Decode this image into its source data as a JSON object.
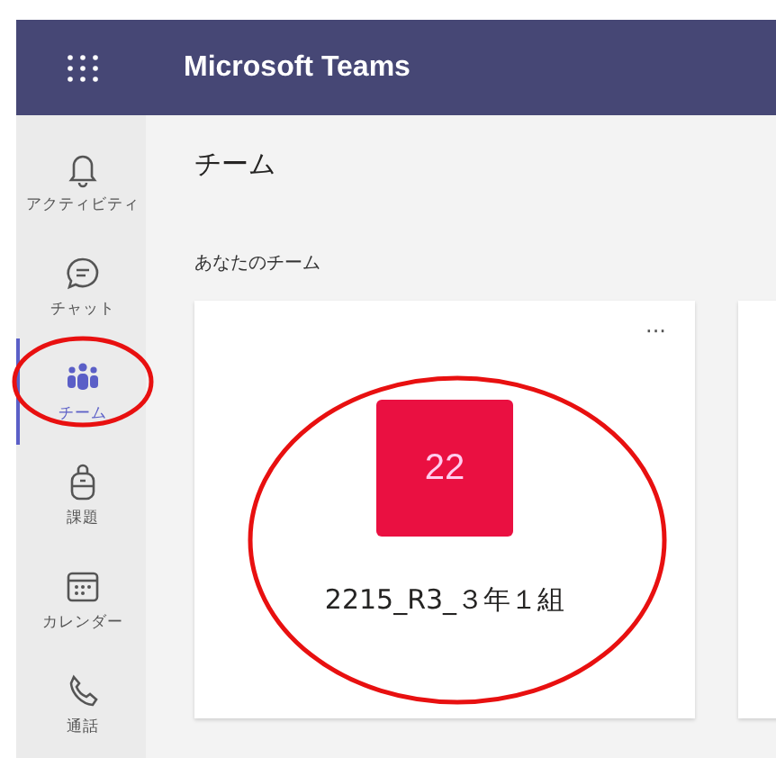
{
  "header": {
    "title": "Microsoft Teams"
  },
  "sidebar": {
    "items": [
      {
        "kind": "bell",
        "label": "アクティビティ",
        "selected": false
      },
      {
        "kind": "chat",
        "label": "チャット",
        "selected": false
      },
      {
        "kind": "teams",
        "label": "チーム",
        "selected": true
      },
      {
        "kind": "backpack",
        "label": "課題",
        "selected": false
      },
      {
        "kind": "calendar",
        "label": "カレンダー",
        "selected": false
      },
      {
        "kind": "phone",
        "label": "通話",
        "selected": false
      }
    ]
  },
  "page_title": "チーム",
  "section_label": "あなたのチーム",
  "teams": [
    {
      "initials": "22",
      "name": "2215_R3_３年１組",
      "color": "#ea1041",
      "more": "···"
    }
  ]
}
